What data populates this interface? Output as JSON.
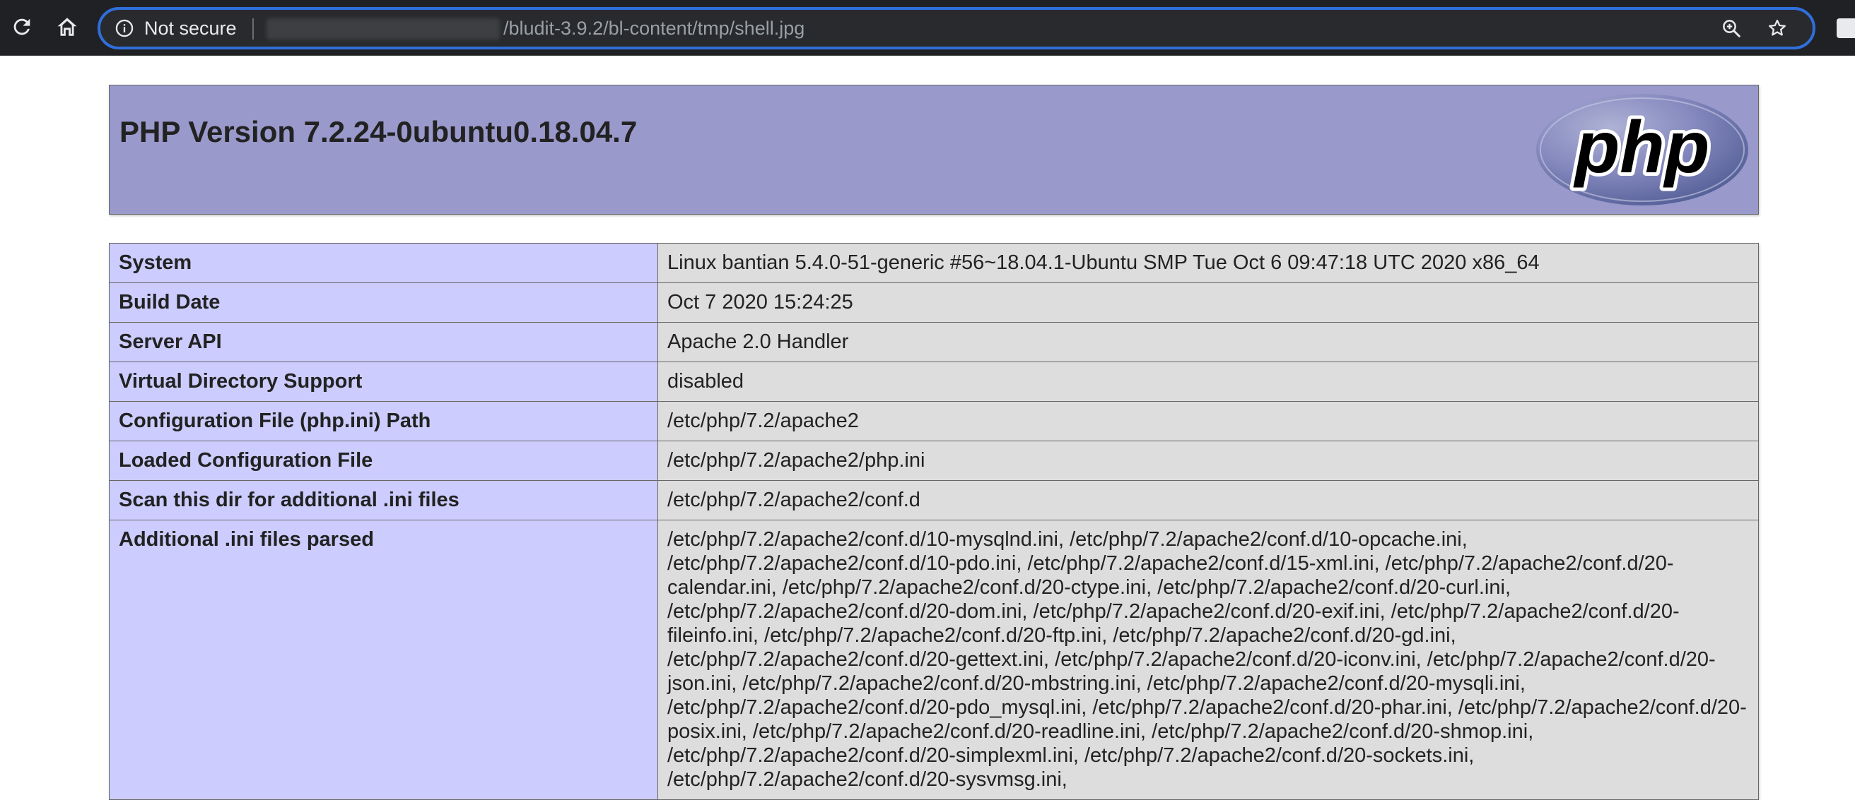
{
  "browser": {
    "security_label": "Not secure",
    "url_path": "/bludit-3.9.2/bl-content/tmp/shell.jpg"
  },
  "php": {
    "title": "PHP Version 7.2.24-0ubuntu0.18.04.7",
    "logo_text": "php",
    "rows": [
      {
        "key": "System",
        "value": "Linux bantian 5.4.0-51-generic #56~18.04.1-Ubuntu SMP Tue Oct 6 09:47:18 UTC 2020 x86_64"
      },
      {
        "key": "Build Date",
        "value": "Oct 7 2020 15:24:25"
      },
      {
        "key": "Server API",
        "value": "Apache 2.0 Handler"
      },
      {
        "key": "Virtual Directory Support",
        "value": "disabled"
      },
      {
        "key": "Configuration File (php.ini) Path",
        "value": "/etc/php/7.2/apache2"
      },
      {
        "key": "Loaded Configuration File",
        "value": "/etc/php/7.2/apache2/php.ini"
      },
      {
        "key": "Scan this dir for additional .ini files",
        "value": "/etc/php/7.2/apache2/conf.d"
      },
      {
        "key": "Additional .ini files parsed",
        "value": "/etc/php/7.2/apache2/conf.d/10-mysqlnd.ini, /etc/php/7.2/apache2/conf.d/10-opcache.ini, /etc/php/7.2/apache2/conf.d/10-pdo.ini, /etc/php/7.2/apache2/conf.d/15-xml.ini, /etc/php/7.2/apache2/conf.d/20-calendar.ini, /etc/php/7.2/apache2/conf.d/20-ctype.ini, /etc/php/7.2/apache2/conf.d/20-curl.ini, /etc/php/7.2/apache2/conf.d/20-dom.ini, /etc/php/7.2/apache2/conf.d/20-exif.ini, /etc/php/7.2/apache2/conf.d/20-fileinfo.ini, /etc/php/7.2/apache2/conf.d/20-ftp.ini, /etc/php/7.2/apache2/conf.d/20-gd.ini, /etc/php/7.2/apache2/conf.d/20-gettext.ini, /etc/php/7.2/apache2/conf.d/20-iconv.ini, /etc/php/7.2/apache2/conf.d/20-json.ini, /etc/php/7.2/apache2/conf.d/20-mbstring.ini, /etc/php/7.2/apache2/conf.d/20-mysqli.ini, /etc/php/7.2/apache2/conf.d/20-pdo_mysql.ini, /etc/php/7.2/apache2/conf.d/20-phar.ini, /etc/php/7.2/apache2/conf.d/20-posix.ini, /etc/php/7.2/apache2/conf.d/20-readline.ini, /etc/php/7.2/apache2/conf.d/20-shmop.ini, /etc/php/7.2/apache2/conf.d/20-simplexml.ini, /etc/php/7.2/apache2/conf.d/20-sockets.ini, /etc/php/7.2/apache2/conf.d/20-sysvmsg.ini,"
      }
    ]
  },
  "icons": {
    "reload": "reload-icon",
    "home": "home-icon",
    "info": "info-icon",
    "zoom": "zoom-icon",
    "bookmark": "star-icon",
    "extension": "extension-icon"
  },
  "colors": {
    "toolbar_bg": "#202124",
    "focus_ring": "#2f6fdb",
    "php_header_bg": "#9999cc",
    "key_cell_bg": "#ccccff",
    "value_cell_bg": "#dddddd"
  }
}
